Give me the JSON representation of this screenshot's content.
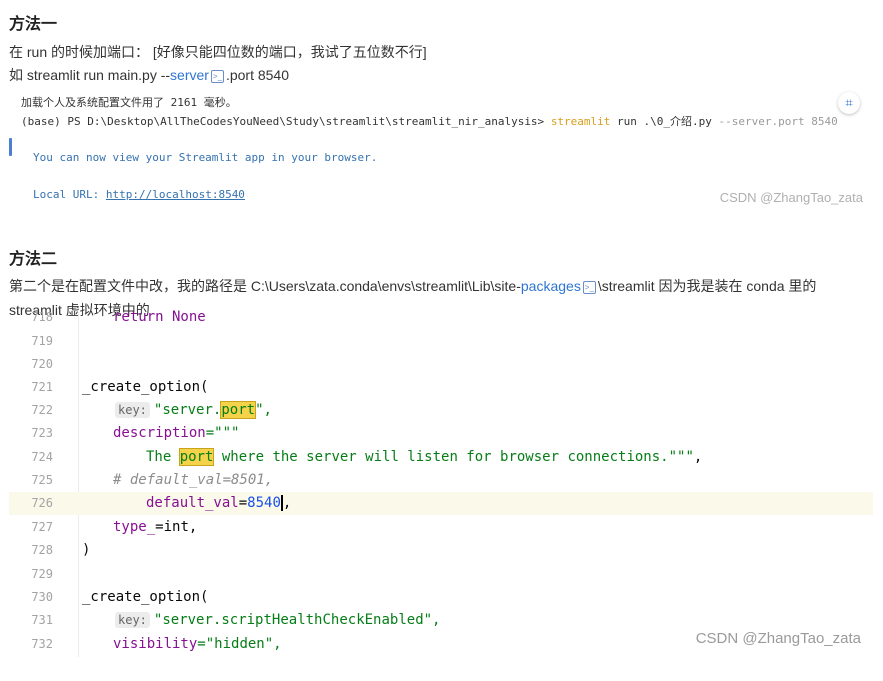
{
  "section1": {
    "heading": "方法一",
    "line1": "在 run 的时候加端口： [好像只能四位数的端口，我试了五位数不行]",
    "line2_prefix": "如 streamlit run main.py --",
    "line2_link": "server",
    "line2_suffix": ".port 8540"
  },
  "terminal": {
    "line1": "加载个人及系统配置文件用了 2161 毫秒。",
    "prompt": "(base) PS D:\\Desktop\\AllTheCodesYouNeed\\Study\\streamlit\\streamlit_nir_analysis> ",
    "cmd": "streamlit",
    "args": " run .\\0_介绍.py ",
    "flag": " --server.port 8540",
    "msg": "You can now view your Streamlit app in your browser.",
    "local_label": "Local URL: ",
    "local_url": "http://localhost:8540",
    "watermark": "CSDN @ZhangTao_zata"
  },
  "section2": {
    "heading": "方法二",
    "line1_prefix": "第二个是在配置文件中改，我的路径是 C:\\Users\\zata.conda\\envs\\streamlit\\Lib\\site-",
    "line1_link": "packages",
    "line1_suffix": "\\streamlit 因为我是装在 conda 里的",
    "line2": "streamlit 虚拟环境中的"
  },
  "code": {
    "lines": [
      "718",
      "719",
      "720",
      "721",
      "722",
      "723",
      "724",
      "725",
      "726",
      "727",
      "728",
      "729",
      "730",
      "731",
      "732"
    ],
    "l718": "return None",
    "create_option": "_create_option(",
    "key_hint": "key:",
    "server_port_a": "\"server.",
    "server_port_b": "port",
    "server_port_c": "\",",
    "description": "description",
    "eq_triple": "=\"\"\"",
    "the": "The ",
    "port": "port",
    "desc_text": " where the server will listen for browser connections.\"\"\"",
    "comma": ",",
    "comment": "# default_val=8501,",
    "default_val": "default_val",
    "eq": "=",
    "val_a": "854",
    "val_b": "0",
    "type_kw": "type_",
    "type_val": "=int,",
    "close": ")",
    "health": "\"server.scriptHealthCheckEnabled\",",
    "visibility": "visibility",
    "vis_val": "=\"hidden\","
  },
  "watermark2": "CSDN @ZhangTao_zata"
}
